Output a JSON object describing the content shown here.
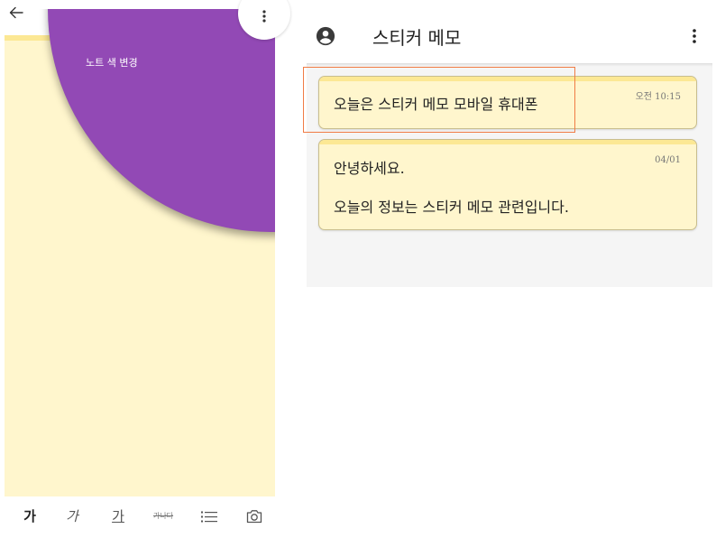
{
  "colors": {
    "page_background": "#FFFFFF",
    "note_background": "#FFF6CD",
    "note_top_bar": "#FCE894",
    "color_menu": "#9249B5",
    "list_background": "#F5F5F5",
    "card_border": "#C9BE8E",
    "highlight_border": "#F07C45"
  },
  "editor": {
    "back_icon": "arrow-left-icon",
    "more_icon": "more-vertical-icon",
    "color_menu": {
      "label": "노트 색 변경"
    },
    "toolbar": {
      "bold_label": "가",
      "italic_label": "가",
      "underline_label": "가",
      "strikethrough_label": "가나다",
      "list_icon": "list-icon",
      "image_icon": "camera-icon"
    }
  },
  "note_list": {
    "account_icon": "account-circle-icon",
    "title": "스티커 메모",
    "more_icon": "more-vertical-icon",
    "notes": [
      {
        "lines": [
          "오늘은 스티커 메모 모바일 휴대폰"
        ],
        "timestamp": "오전 10:15",
        "highlighted": true
      },
      {
        "lines": [
          "안녕하세요.",
          "오늘의 정보는 스티커 메모 관련입니다."
        ],
        "timestamp": "04/01",
        "highlighted": false
      }
    ]
  }
}
